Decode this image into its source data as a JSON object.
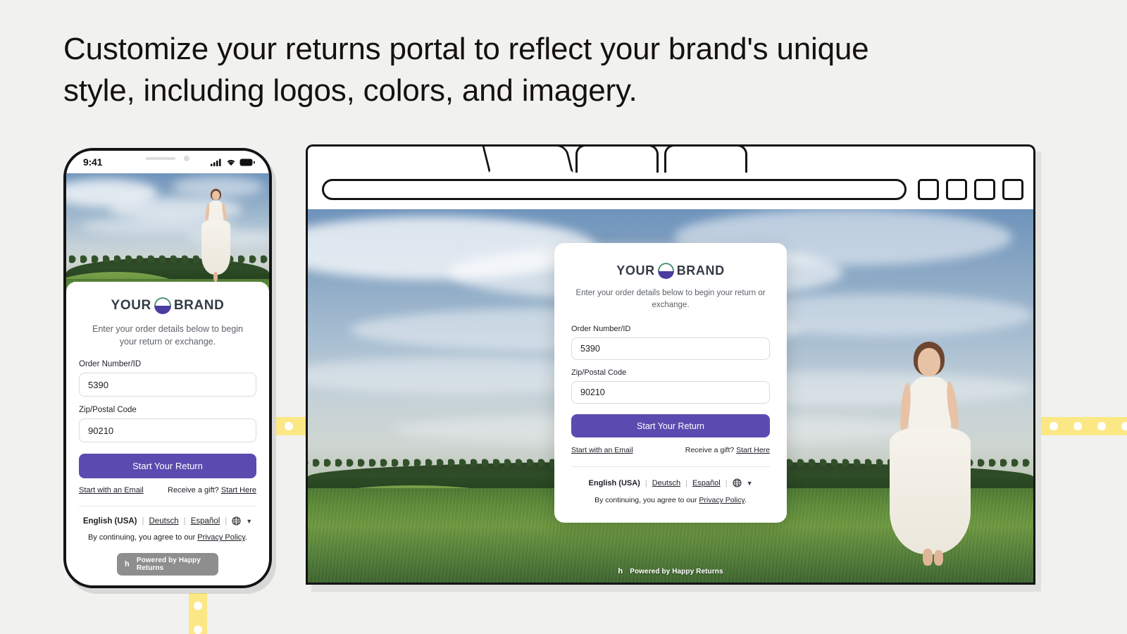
{
  "headline": "Customize your returns portal to reflect your brand's unique style, including logos, colors, and imagery.",
  "colors": {
    "page_background": "#f1f1ef",
    "accent_purple": "#5b4bb0",
    "brand_mark_top": "#4a8f74",
    "brand_mark_bottom": "#4a3da0",
    "accent_yellow": "#fbe884",
    "outline_black": "#141414"
  },
  "phone": {
    "status_bar": {
      "time": "9:41",
      "icons": [
        "cellular-signal-icon",
        "wifi-icon",
        "battery-icon"
      ]
    }
  },
  "browser": {
    "tabs": [
      {
        "label": "",
        "active": true
      },
      {
        "label": "",
        "active": false
      },
      {
        "label": "",
        "active": false
      }
    ],
    "url_value": "",
    "url_placeholder": "",
    "window_buttons": [
      "button-1",
      "button-2",
      "button-3",
      "button-4"
    ]
  },
  "portal": {
    "brand": {
      "word_left": "YOUR",
      "word_right": "BRAND",
      "mark_icon": "brand-circle-icon"
    },
    "subtitle": "Enter your order details below to begin your return or exchange.",
    "fields": [
      {
        "label": "Order Number/ID",
        "value": "5390",
        "placeholder": "Order Number/ID"
      },
      {
        "label": "Zip/Postal Code",
        "value": "90210",
        "placeholder": "Zip/Postal Code"
      }
    ],
    "cta_label": "Start Your Return",
    "links": {
      "email_link": "Start with an Email",
      "gift_prefix": "Receive a gift?",
      "gift_link": "Start Here"
    },
    "languages": {
      "current": "English (USA)",
      "others": [
        "Deutsch",
        "Español"
      ],
      "globe_icon": "globe-icon",
      "chevron_icon": "chevron-down-icon"
    },
    "legal": {
      "prefix": "By continuing, you agree to our",
      "link": "Privacy Policy",
      "suffix": "."
    },
    "powered_by": {
      "mark": "h",
      "label": "Powered by Happy Returns"
    }
  },
  "decor": {
    "strip_dot_icon": "film-strip-dot"
  }
}
